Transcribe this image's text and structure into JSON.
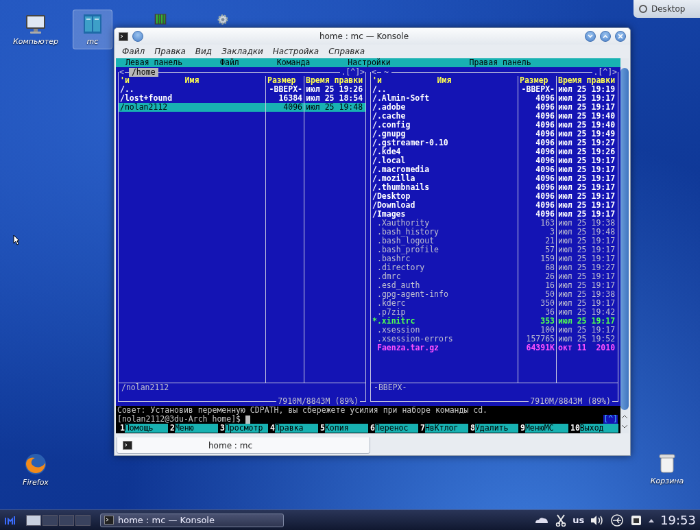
{
  "desktop_widget": {
    "label": "Desktop"
  },
  "desktop_icons": [
    {
      "kind": "computer",
      "label": "Компьютер",
      "selected": false
    },
    {
      "kind": "terminal",
      "label": "mc",
      "selected": true
    },
    {
      "kind": "monitor",
      "selected": false
    },
    {
      "kind": "settings",
      "selected": false
    },
    {
      "kind": "firefox",
      "label": "Firefox",
      "selected": false
    },
    {
      "kind": "trash",
      "label": "Корзина",
      "selected": false
    }
  ],
  "window": {
    "title": "home : mc — Konsole",
    "menu": [
      "Файл",
      "Правка",
      "Вид",
      "Закладки",
      "Настройка",
      "Справка"
    ],
    "tabs": [
      {
        "label": "home : mc",
        "selected": true
      }
    ]
  },
  "mc": {
    "menu": [
      "Левая панель",
      "Файл",
      "Команда",
      "Настройки",
      "Правая панель"
    ],
    "panels": [
      {
        "left_mark": "<",
        "path": "/home",
        "active": true,
        "right_mark": ".[^]>",
        "sort": "'и",
        "columns": [
          "Имя",
          "Размер",
          "Время правки"
        ],
        "rows": [
          {
            "name": "/..",
            "size": "-ВВЕРХ-",
            "time": "июл 25 19:26",
            "kind": "dir",
            "selected": false
          },
          {
            "name": "/lost+found",
            "size": "16384",
            "time": "июл 25 18:54",
            "kind": "dir",
            "selected": false
          },
          {
            "name": "/nolan2112",
            "size": "4096",
            "time": "июл 25 19:48",
            "kind": "dir",
            "selected": true
          }
        ],
        "status": "/nolan2112",
        "free": "7910M/8843M (89%)"
      },
      {
        "left_mark": "<",
        "path": "~",
        "active": false,
        "right_mark": ".[^]>",
        "sort": "'и",
        "columns": [
          "Имя",
          "Размер",
          "Время правки"
        ],
        "rows": [
          {
            "name": "/..",
            "size": "-ВВЕРХ-",
            "time": "июл 25 19:19",
            "kind": "dir",
            "selected": false
          },
          {
            "name": "/.Almin-Soft",
            "size": "4096",
            "time": "июл 25 19:17",
            "kind": "dir",
            "selected": false
          },
          {
            "name": "/.adobe",
            "size": "4096",
            "time": "июл 25 19:17",
            "kind": "dir",
            "selected": false
          },
          {
            "name": "/.cache",
            "size": "4096",
            "time": "июл 25 19:40",
            "kind": "dir",
            "selected": false
          },
          {
            "name": "/.config",
            "size": "4096",
            "time": "июл 25 19:40",
            "kind": "dir",
            "selected": false
          },
          {
            "name": "/.gnupg",
            "size": "4096",
            "time": "июл 25 19:49",
            "kind": "dir",
            "selected": false
          },
          {
            "name": "/.gstreamer-0.10",
            "size": "4096",
            "time": "июл 25 19:27",
            "kind": "dir",
            "selected": false
          },
          {
            "name": "/.kde4",
            "size": "4096",
            "time": "июл 25 19:26",
            "kind": "dir",
            "selected": false
          },
          {
            "name": "/.local",
            "size": "4096",
            "time": "июл 25 19:17",
            "kind": "dir",
            "selected": false
          },
          {
            "name": "/.macromedia",
            "size": "4096",
            "time": "июл 25 19:17",
            "kind": "dir",
            "selected": false
          },
          {
            "name": "/.mozilla",
            "size": "4096",
            "time": "июл 25 19:17",
            "kind": "dir",
            "selected": false
          },
          {
            "name": "/.thumbnails",
            "size": "4096",
            "time": "июл 25 19:17",
            "kind": "dir",
            "selected": false
          },
          {
            "name": "/Desktop",
            "size": "4096",
            "time": "июл 25 19:17",
            "kind": "dir",
            "selected": false
          },
          {
            "name": "/Download",
            "size": "4096",
            "time": "июл 25 19:17",
            "kind": "dir",
            "selected": false
          },
          {
            "name": "/Images",
            "size": "4096",
            "time": "июл 25 19:17",
            "kind": "dir",
            "selected": false
          },
          {
            "name": ".Xauthority",
            "size": "163",
            "time": "июл 25 19:38",
            "kind": "file",
            "selected": false
          },
          {
            "name": ".bash_history",
            "size": "3",
            "time": "июл 25 19:48",
            "kind": "file",
            "selected": false
          },
          {
            "name": ".bash_logout",
            "size": "21",
            "time": "июл 25 19:17",
            "kind": "file",
            "selected": false
          },
          {
            "name": ".bash_profile",
            "size": "57",
            "time": "июл 25 19:17",
            "kind": "file",
            "selected": false
          },
          {
            "name": ".bashrc",
            "size": "159",
            "time": "июл 25 19:17",
            "kind": "file",
            "selected": false
          },
          {
            "name": ".directory",
            "size": "68",
            "time": "июл 25 19:27",
            "kind": "file",
            "selected": false
          },
          {
            "name": ".dmrc",
            "size": "26",
            "time": "июл 25 19:17",
            "kind": "file",
            "selected": false
          },
          {
            "name": ".esd_auth",
            "size": "16",
            "time": "июл 25 19:17",
            "kind": "file",
            "selected": false
          },
          {
            "name": ".gpg-agent-info",
            "size": "50",
            "time": "июл 25 19:38",
            "kind": "file",
            "selected": false
          },
          {
            "name": ".kderc",
            "size": "350",
            "time": "июл 25 19:17",
            "kind": "file",
            "selected": false
          },
          {
            "name": ".p7zip",
            "size": "36",
            "time": "июл 25 19:42",
            "kind": "file",
            "selected": false
          },
          {
            "name": "*.xinitrc",
            "size": "353",
            "time": "июл 25 19:17",
            "kind": "exec",
            "selected": false
          },
          {
            "name": ".xsession",
            "size": "100",
            "time": "июл 25 19:17",
            "kind": "file",
            "selected": false
          },
          {
            "name": ".xsession-errors",
            "size": "157765",
            "time": "июл 25 19:52",
            "kind": "file",
            "selected": false
          },
          {
            "name": "Faenza.tar.gz",
            "size": "64391K",
            "time": "окт 11  2010",
            "kind": "archive",
            "selected": false
          }
        ],
        "status": "-ВВЕРХ-",
        "free": "7910M/8843M (89%)"
      }
    ],
    "hint": "Совет: Установив переменную CDPATH, вы сбережете усилия при наборе команды cd.",
    "prompt": "[nolan2112@3du-Arch home]$",
    "corner": "[^]",
    "keys": [
      {
        "num": "1",
        "label": "Помощь"
      },
      {
        "num": "2",
        "label": "Меню"
      },
      {
        "num": "3",
        "label": "Просмотр"
      },
      {
        "num": "4",
        "label": "Правка"
      },
      {
        "num": "5",
        "label": "Копия"
      },
      {
        "num": "6",
        "label": "Перенос"
      },
      {
        "num": "7",
        "label": "НвКтлог"
      },
      {
        "num": "8",
        "label": "Удалить"
      },
      {
        "num": "9",
        "label": "МенюМС"
      },
      {
        "num": "10",
        "label": "Выход"
      }
    ]
  },
  "taskbar": {
    "pager": [
      {
        "selected": true
      },
      {
        "selected": false
      },
      {
        "selected": false
      },
      {
        "selected": false
      }
    ],
    "tasks": [
      {
        "label": "home : mc — Konsole",
        "selected": true
      }
    ],
    "layout": "us",
    "clock": "19:53"
  }
}
